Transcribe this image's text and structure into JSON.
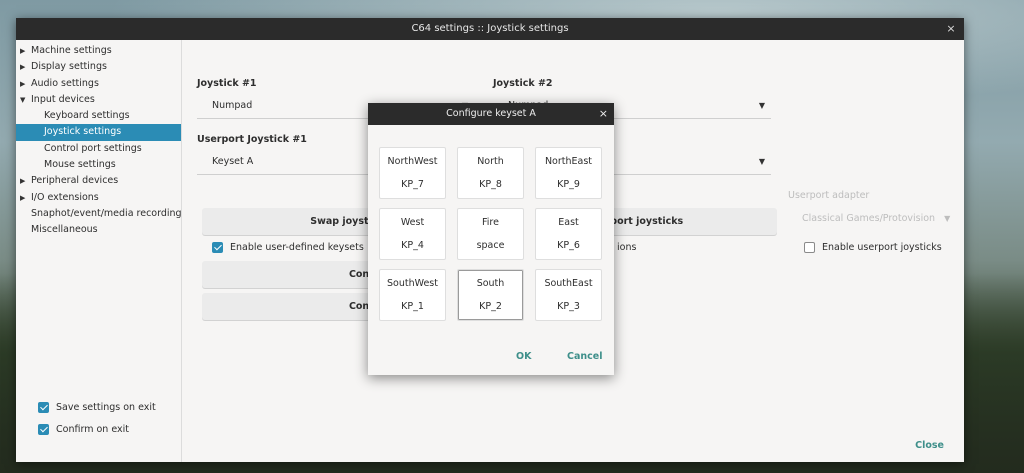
{
  "window": {
    "title": "C64 settings :: Joystick settings",
    "close_icon": "×"
  },
  "sidebar": {
    "items": [
      {
        "label": "Machine settings",
        "toggle": "▶",
        "level": 0
      },
      {
        "label": "Display settings",
        "toggle": "▶",
        "level": 0
      },
      {
        "label": "Audio settings",
        "toggle": "▶",
        "level": 0
      },
      {
        "label": "Input devices",
        "toggle": "▼",
        "level": 0
      },
      {
        "label": "Keyboard settings",
        "toggle": "",
        "level": 1
      },
      {
        "label": "Joystick settings",
        "toggle": "",
        "level": 1,
        "selected": true
      },
      {
        "label": "Control port settings",
        "toggle": "",
        "level": 1
      },
      {
        "label": "Mouse settings",
        "toggle": "",
        "level": 1
      },
      {
        "label": "Peripheral devices",
        "toggle": "▶",
        "level": 0
      },
      {
        "label": "I/O extensions",
        "toggle": "▶",
        "level": 0
      },
      {
        "label": "Snaphot/event/media recording",
        "toggle": "",
        "level": 0
      },
      {
        "label": "Miscellaneous",
        "toggle": "",
        "level": 0
      }
    ],
    "save_on_exit": "Save settings on exit",
    "confirm_on_exit": "Confirm on exit"
  },
  "main": {
    "joystick1_label": "Joystick #1",
    "joystick1_value": "Numpad",
    "joystick2_label": "Joystick #2",
    "joystick2_value": "Numpad",
    "userport1_label": "Userport Joystick #1",
    "userport1_value": "Keyset A",
    "userport_adapter_label": "Userport adapter",
    "userport_adapter_value": "Classical Games/Protovision",
    "swap_joysticks_btn": "Swap joystick",
    "swap_userport_btn": "Userport joysticks",
    "enable_keysets": "Enable user-defined keysets",
    "options_fragment": "ions",
    "enable_userport": "Enable userport joysticks",
    "configure_a_btn": "Configure keyse",
    "configure_b_btn": "Configure keyse",
    "dropdown_arrow": "▼"
  },
  "dialog": {
    "title": "Configure keyset A",
    "close_icon": "×",
    "keys": [
      {
        "dir": "NorthWest",
        "val": "KP_7"
      },
      {
        "dir": "North",
        "val": "KP_8"
      },
      {
        "dir": "NorthEast",
        "val": "KP_9"
      },
      {
        "dir": "West",
        "val": "KP_4"
      },
      {
        "dir": "Fire",
        "val": "space"
      },
      {
        "dir": "East",
        "val": "KP_6"
      },
      {
        "dir": "SouthWest",
        "val": "KP_1"
      },
      {
        "dir": "South",
        "val": "KP_2"
      },
      {
        "dir": "SouthEast",
        "val": "KP_3"
      }
    ],
    "ok": "OK",
    "cancel": "Cancel"
  },
  "footer": {
    "close": "Close"
  },
  "colors": {
    "accent": "#2b8cb5",
    "link": "#3e8f8a",
    "titlebar": "#2b2b2b"
  }
}
